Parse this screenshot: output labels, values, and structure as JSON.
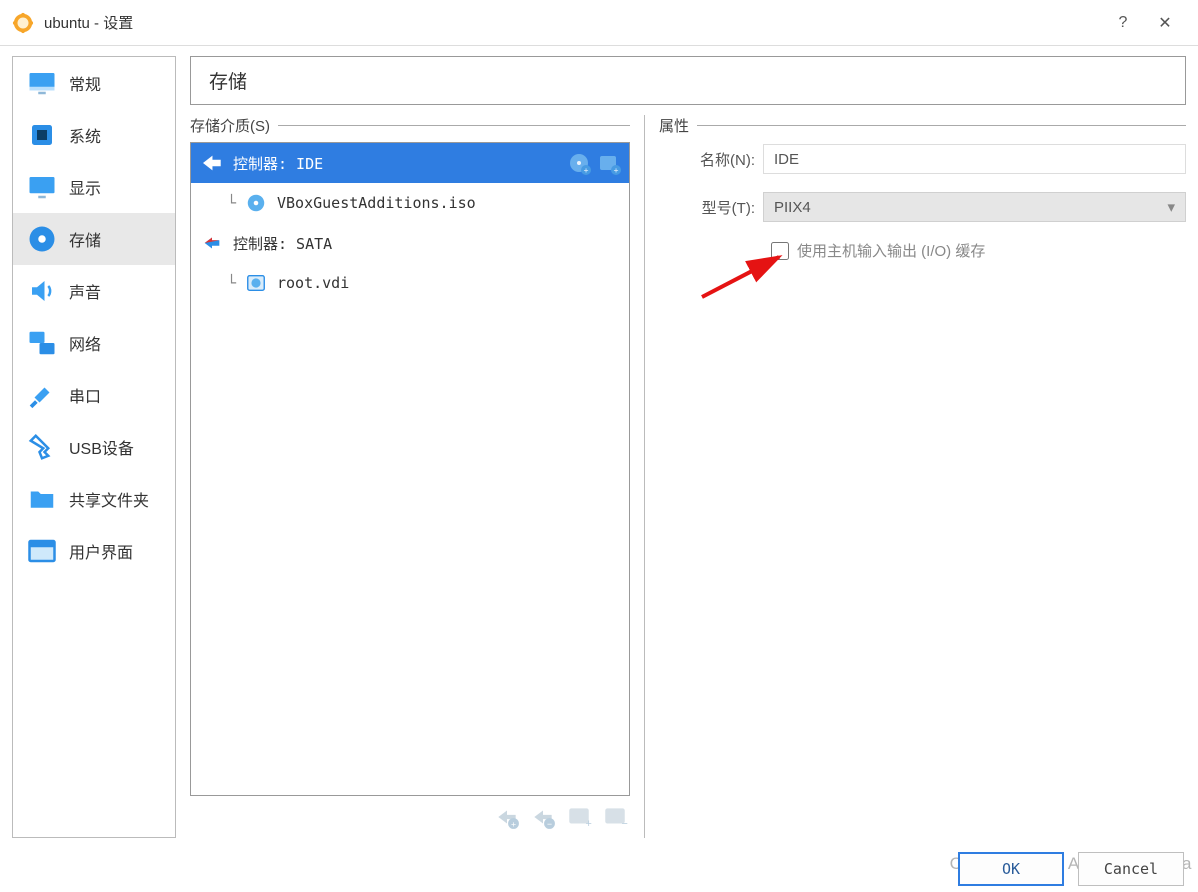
{
  "window": {
    "title": "ubuntu - 设置",
    "help": "?",
    "close": "✕"
  },
  "sidebar": {
    "items": [
      {
        "id": "general",
        "label": "常规"
      },
      {
        "id": "system",
        "label": "系统"
      },
      {
        "id": "display",
        "label": "显示"
      },
      {
        "id": "storage",
        "label": "存储"
      },
      {
        "id": "audio",
        "label": "声音"
      },
      {
        "id": "network",
        "label": "网络"
      },
      {
        "id": "serial",
        "label": "串口"
      },
      {
        "id": "usb",
        "label": "USB设备"
      },
      {
        "id": "shared",
        "label": "共享文件夹"
      },
      {
        "id": "ui",
        "label": "用户界面"
      }
    ],
    "selected": "storage"
  },
  "content": {
    "title": "存储",
    "storage_legend": "存储介质(S)",
    "attrs_legend": "属性",
    "tree": {
      "controllers": [
        {
          "name": "控制器: IDE",
          "selected": true,
          "attachments": [
            {
              "name": "VBoxGuestAdditions.iso",
              "type": "cd"
            }
          ]
        },
        {
          "name": "控制器: SATA",
          "selected": false,
          "attachments": [
            {
              "name": "root.vdi",
              "type": "hdd"
            }
          ]
        }
      ]
    },
    "attrs": {
      "name_label": "名称(N):",
      "name_value": "IDE",
      "type_label": "型号(T):",
      "type_value": "PIIX4",
      "cache_label": "使用主机输入输出 (I/O) 缓存",
      "cache_checked": false
    }
  },
  "footer": {
    "ok": "OK",
    "cancel": "Cancel"
  },
  "watermark": "CSDN @Wing Ardium Leviosa"
}
